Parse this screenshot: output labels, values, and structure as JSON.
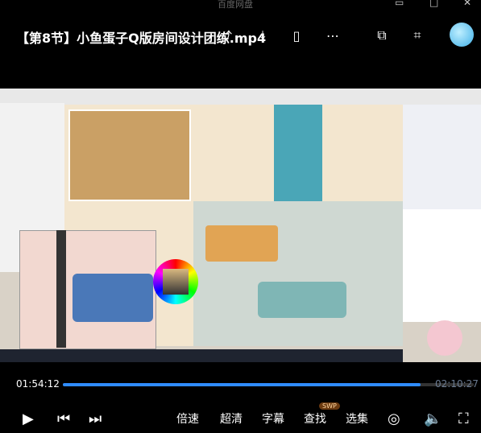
{
  "window": {
    "app_name": "百度网盘"
  },
  "header": {
    "title": "【第8节】小鱼蛋子Q版房间设计团练.mp4",
    "icons": [
      "share-icon",
      "download-icon",
      "phone-icon",
      "more-icon",
      "cast-icon",
      "crop-icon",
      "avatar"
    ]
  },
  "player": {
    "current_time": "01:54:12",
    "total_time": "02:10:27",
    "progress": 0.87,
    "controls": {
      "speed": "倍速",
      "quality": "超清",
      "subtitle": "字幕",
      "search": "查找",
      "search_badge": "SWP",
      "episodes": "选集"
    }
  }
}
